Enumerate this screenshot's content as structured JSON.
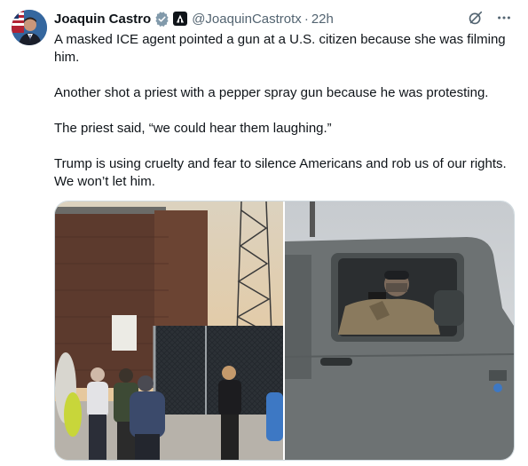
{
  "tweet": {
    "author_name": "Joaquin Castro",
    "handle": "@JoaquinCastrotx",
    "separator": "·",
    "time": "22h",
    "body": [
      "A masked ICE agent pointed a gun at a U.S. citizen because she was filming him.",
      "Another shot a priest with a pepper spray gun because he was protesting.",
      "The priest said, “we could hear them laughing.”",
      "Trump is using cruelty and fear to silence Americans and rob us of our rights. We won’t let him."
    ],
    "icons": {
      "verified": "verified-badge-icon",
      "affiliation": "government-affiliation-icon",
      "grok": "grok-icon",
      "more": "more-icon"
    },
    "media": {
      "left_sign": "",
      "left_alt": "protest-at-fence-photo",
      "right_alt": "masked-agent-in-jeep-photo"
    }
  },
  "colors": {
    "text": "#0f1419",
    "secondary": "#536471",
    "verified": "#829aab",
    "border": "#cfd9de"
  }
}
